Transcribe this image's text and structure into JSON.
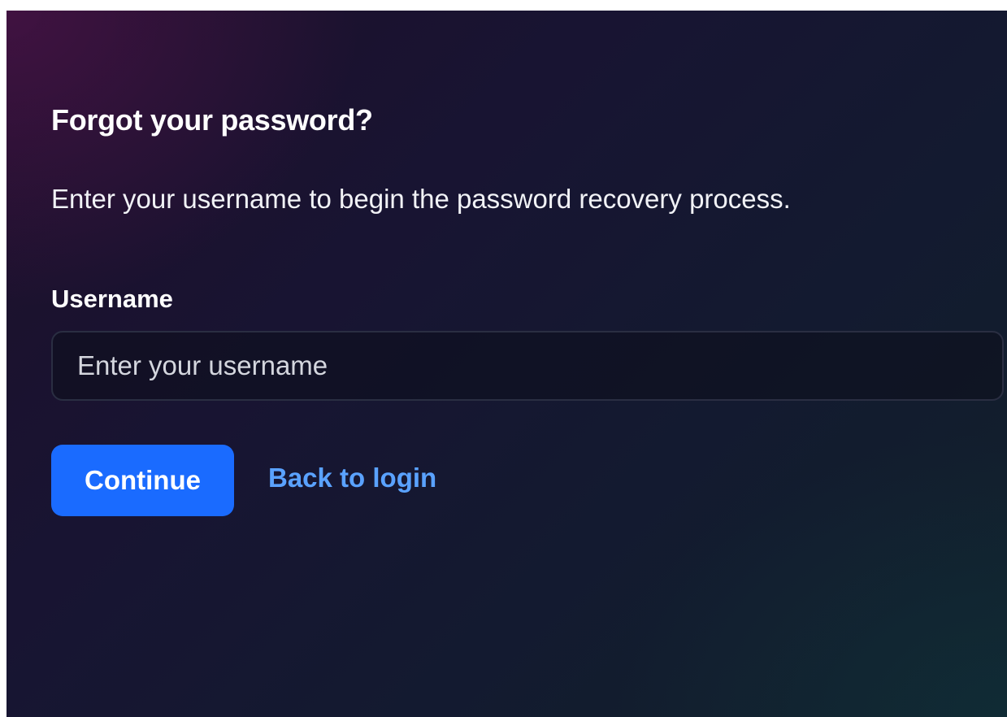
{
  "form": {
    "title": "Forgot your password?",
    "description": "Enter your username to begin the password recovery process.",
    "username_label": "Username",
    "username_value": "",
    "username_placeholder": "Enter your username",
    "continue_label": "Continue",
    "back_link_label": "Back to login"
  },
  "colors": {
    "primary_button": "#1a6bff",
    "link": "#5aa2ff",
    "text": "#ffffff"
  }
}
